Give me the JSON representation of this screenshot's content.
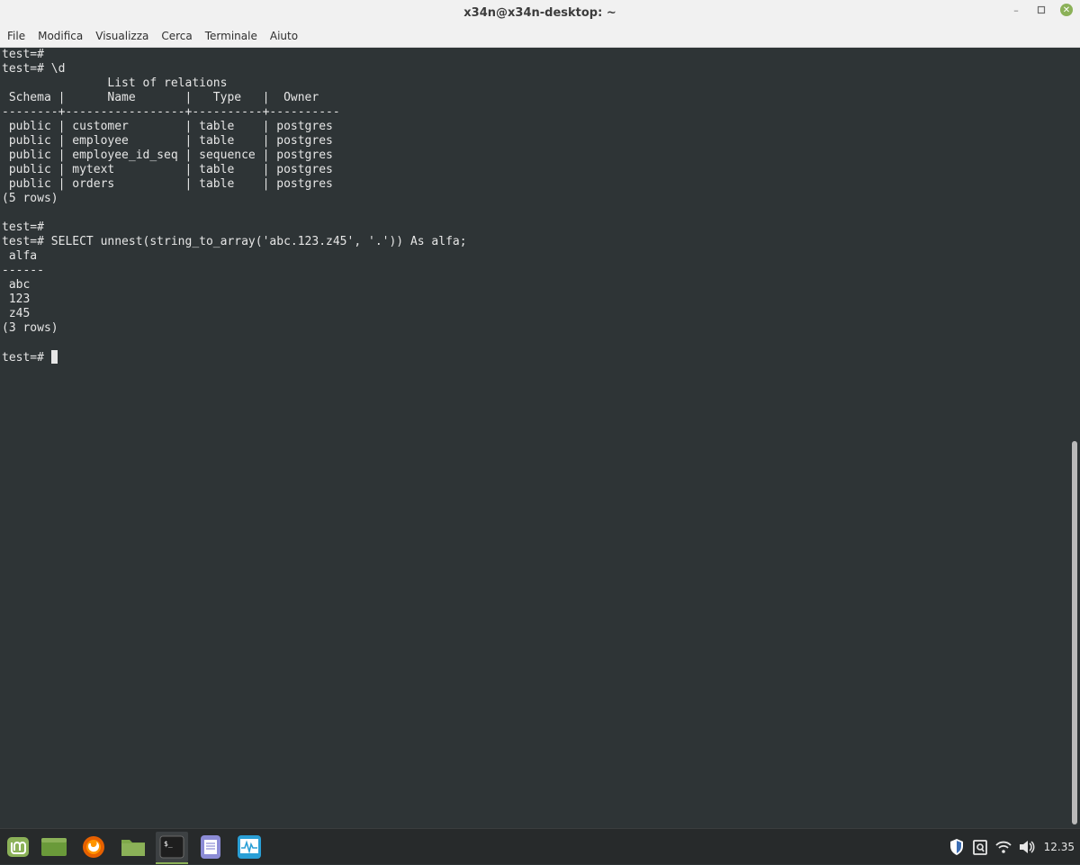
{
  "window": {
    "title": "x34n@x34n-desktop: ~",
    "controls": {
      "minimize": "–",
      "maximize": "▫",
      "close": "✕"
    }
  },
  "menubar": {
    "items": [
      "File",
      "Modifica",
      "Visualizza",
      "Cerca",
      "Terminale",
      "Aiuto"
    ]
  },
  "terminal": {
    "lines": [
      "test=#",
      "test=# \\d",
      "               List of relations",
      " Schema |      Name       |   Type   |  Owner   ",
      "--------+-----------------+----------+----------",
      " public | customer        | table    | postgres",
      " public | employee        | table    | postgres",
      " public | employee_id_seq | sequence | postgres",
      " public | mytext          | table    | postgres",
      " public | orders          | table    | postgres",
      "(5 rows)",
      "",
      "test=#",
      "test=# SELECT unnest(string_to_array('abc.123.z45', '.')) As alfa;",
      " alfa ",
      "------",
      " abc",
      " 123",
      " z45",
      "(3 rows)",
      "",
      "test=# "
    ],
    "colors": {
      "background": "#2e3436",
      "foreground": "#e6e6e6"
    }
  },
  "taskbar": {
    "apps": [
      {
        "name": "mint-menu-icon"
      },
      {
        "name": "show-desktop-icon"
      },
      {
        "name": "firefox-icon"
      },
      {
        "name": "files-icon"
      },
      {
        "name": "terminal-icon",
        "active": true
      },
      {
        "name": "text-editor-icon"
      },
      {
        "name": "system-monitor-icon"
      }
    ],
    "tray": {
      "icons": [
        "shield-icon",
        "clipboard-icon",
        "wifi-icon",
        "volume-icon"
      ],
      "clock": "12.35"
    }
  }
}
